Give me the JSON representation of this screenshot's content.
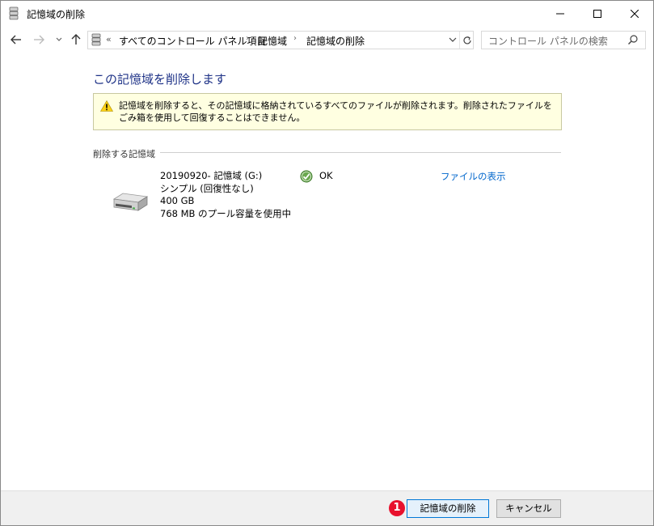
{
  "window": {
    "title": "記憶域の削除"
  },
  "nav": {
    "breadcrumb_prefix": "«",
    "breadcrumbs": [
      "すべてのコントロール パネル項目",
      "記憶域",
      "記憶域の削除"
    ],
    "breadcrumb_separator": "›",
    "search_placeholder": "コントロール パネルの検索"
  },
  "main": {
    "heading": "この記憶域を削除します",
    "warning": "記憶域を削除すると、その記憶域に格納されているすべてのファイルが削除されます。削除されたファイルをごみ箱を使用して回復することはできません。",
    "section_label": "削除する記憶域",
    "drive": {
      "name": "20190920- 記憶域 (G:)",
      "type": "シンプル (回復性なし)",
      "size": "400 GB",
      "pool_usage": "768 MB のプール容量を使用中",
      "status": "OK",
      "view_files_link": "ファイルの表示"
    }
  },
  "footer": {
    "badge": "1",
    "delete_button": "記憶域の削除",
    "cancel_button": "キャンセル"
  },
  "colors": {
    "heading": "#1e3287",
    "link": "#0066cc",
    "warning_bg": "#ffffe1",
    "badge": "#e8112d"
  }
}
